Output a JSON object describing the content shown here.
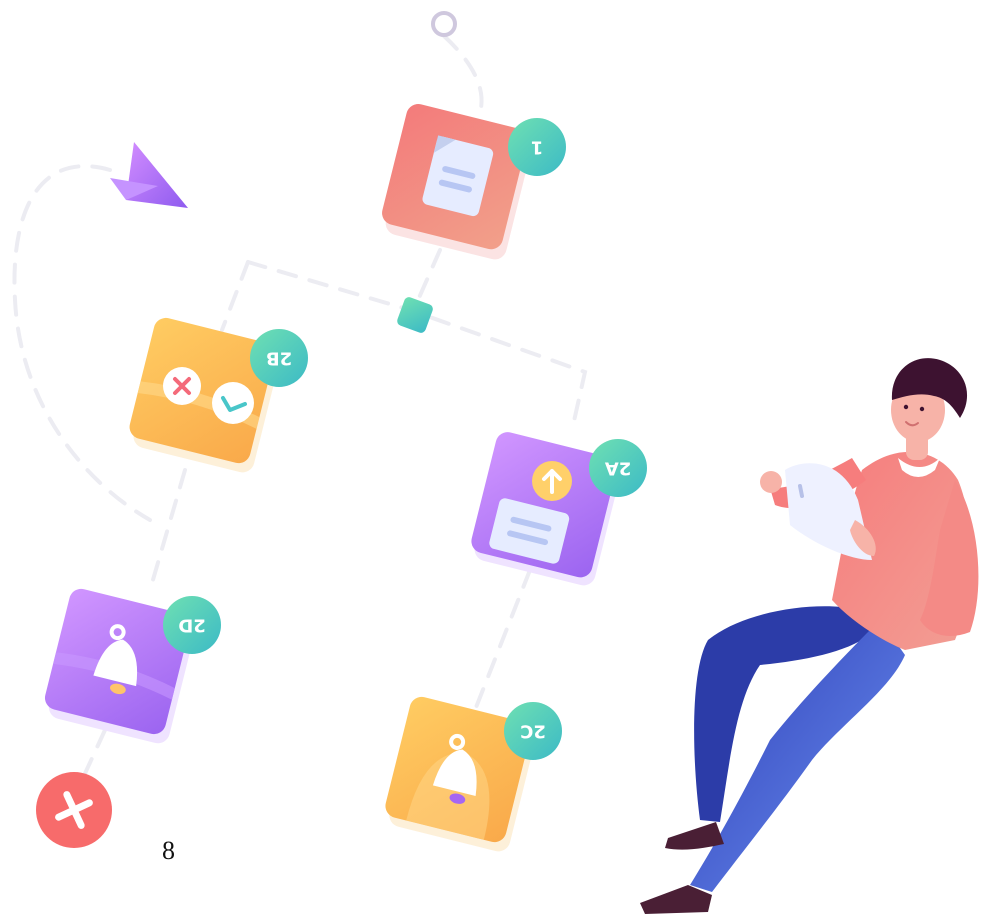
{
  "page_number": "8",
  "steps": [
    {
      "id": "1",
      "label": "1",
      "icon": "document-icon",
      "color": "#f07a7a"
    },
    {
      "id": "2B",
      "label": "2B",
      "icon": "check-cross-icon",
      "color": "#f7b84b"
    },
    {
      "id": "2A",
      "label": "2A",
      "icon": "upload-icon",
      "color": "#b57af7"
    },
    {
      "id": "2D",
      "label": "2D",
      "icon": "bell-icon",
      "color": "#b57af7"
    },
    {
      "id": "2C",
      "label": "2C",
      "icon": "bell-icon",
      "color": "#f7b84b"
    }
  ],
  "badge_color": "#4fd1b6",
  "add_button_color": "#f76b6b",
  "accent_purple": "#a66cf4"
}
